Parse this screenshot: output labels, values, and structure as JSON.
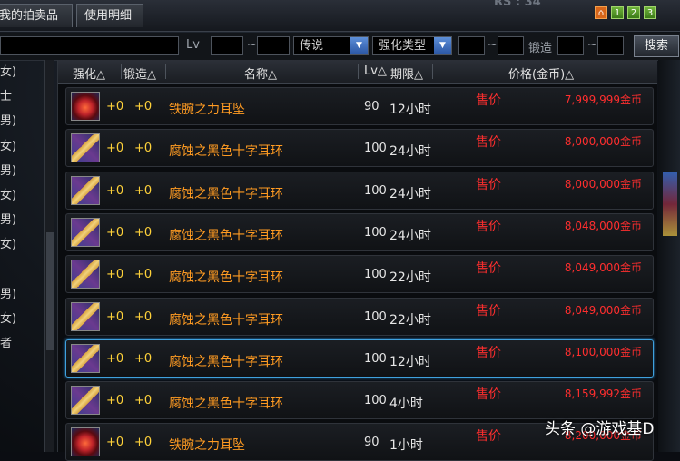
{
  "window": {
    "tabs": [
      "我的拍卖品",
      "使用明细"
    ],
    "rs_label": "RS : 34",
    "page_buttons": [
      "1",
      "2",
      "3"
    ]
  },
  "search": {
    "lv_label": "Lv",
    "tilde1": "~",
    "tilde2": "~",
    "tilde3": "~",
    "rarity": "传说",
    "enhance_type": "强化类型",
    "forge_label": "锻造",
    "search_button": "搜索"
  },
  "left_list": [
    "女)",
    "士",
    "男)",
    "女)",
    "男)",
    "女)",
    "男)",
    "女)",
    "",
    "男)",
    "女)",
    "者"
  ],
  "table": {
    "headers": {
      "enhance": "强化△",
      "forge": "锻造△",
      "name": "名称△",
      "lv": "Lv△",
      "duration": "期限△",
      "price": "价格(金币)△"
    },
    "rows": [
      {
        "icon": "red-ring-icon",
        "enhance": "+0",
        "forge": "+0",
        "name": "铁腕之力耳坠",
        "lv": "90",
        "duration": "12小时",
        "tag": "售价",
        "price": "7,999,999金币"
      },
      {
        "icon": "cross-earring-icon",
        "enhance": "+0",
        "forge": "+0",
        "name": "腐蚀之黑色十字耳环",
        "lv": "100",
        "duration": "24小时",
        "tag": "售价",
        "price": "8,000,000金币"
      },
      {
        "icon": "cross-earring-icon",
        "enhance": "+0",
        "forge": "+0",
        "name": "腐蚀之黑色十字耳环",
        "lv": "100",
        "duration": "24小时",
        "tag": "售价",
        "price": "8,000,000金币"
      },
      {
        "icon": "cross-earring-icon",
        "enhance": "+0",
        "forge": "+0",
        "name": "腐蚀之黑色十字耳环",
        "lv": "100",
        "duration": "24小时",
        "tag": "售价",
        "price": "8,048,000金币"
      },
      {
        "icon": "cross-earring-icon",
        "enhance": "+0",
        "forge": "+0",
        "name": "腐蚀之黑色十字耳环",
        "lv": "100",
        "duration": "22小时",
        "tag": "售价",
        "price": "8,049,000金币"
      },
      {
        "icon": "cross-earring-icon",
        "enhance": "+0",
        "forge": "+0",
        "name": "腐蚀之黑色十字耳环",
        "lv": "100",
        "duration": "22小时",
        "tag": "售价",
        "price": "8,049,000金币"
      },
      {
        "icon": "cross-earring-icon",
        "enhance": "+0",
        "forge": "+0",
        "name": "腐蚀之黑色十字耳环",
        "lv": "100",
        "duration": "12小时",
        "tag": "售价",
        "price": "8,100,000金币",
        "selected": true
      },
      {
        "icon": "cross-earring-icon",
        "enhance": "+0",
        "forge": "+0",
        "name": "腐蚀之黑色十字耳环",
        "lv": "100",
        "duration": "4小时",
        "tag": "售价",
        "price": "8,159,992金币"
      },
      {
        "icon": "red-ring-icon",
        "enhance": "+0",
        "forge": "+0",
        "name": "铁腕之力耳坠",
        "lv": "90",
        "duration": "1小时",
        "tag": "售价",
        "price": "8,200,000金币"
      }
    ]
  },
  "watermark": "头条 @游戏基D",
  "colors": {
    "name": "#ff9b22",
    "price": "#ff2e2e",
    "enhance": "#ffd23a",
    "selected_border": "#3fa1dd"
  }
}
